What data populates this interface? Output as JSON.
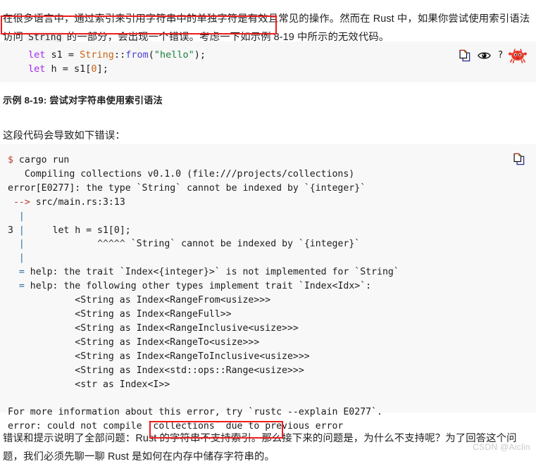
{
  "document": {
    "intro_paragraph": {
      "segment_1": "在很多语言中，通过索引来引用字符串中的单独字符是有效且常见的操作。然而在 Rust 中，如果你尝试使用索引语法访问 ",
      "inline_code": "String",
      "segment_2": " 的一部分，会出现一个错误。考虑一下如示例 8-19 中所示的无效代码。"
    },
    "caption": "示例 8-19: 尝试对字符串使用索引语法",
    "mid_line": "这段代码会导致如下错误：",
    "outro_paragraph": {
      "segment_1": "错误和提示说明了全部问题：",
      "highlighted": "Rust 的字符串不支持索引。",
      "segment_2": "那么接下来的问题是，为什么不支持呢？为了回答这个问题，我们必须先聊一聊 Rust 是如何在内存中储存字符串的。"
    },
    "watermark": "CSDN @Aiclin"
  },
  "code_block": {
    "language": "rust",
    "line_1": {
      "kw_let": "let",
      "var": " s1 = ",
      "type": "String",
      "sep": "::",
      "fn": "from",
      "open": "(",
      "string": "\"hello\"",
      "close": ");"
    },
    "line_2": {
      "kw_let": "let",
      "mid": " h = s1[",
      "num": "0",
      "end": "];"
    },
    "tools": {
      "copy_label": "copy-to-clipboard",
      "eye_label": "show-hidden-lines",
      "question_label": "?",
      "ferris_label": "ferris-not-compile"
    }
  },
  "terminal_block": {
    "lines": [
      "$ cargo run",
      "   Compiling collections v0.1.0 (file:///projects/collections)",
      "error[E0277]: the type `String` cannot be indexed by `{integer}`",
      " --> src/main.rs:3:13",
      "  |",
      "3 |     let h = s1[0];",
      "  |             ^^^^^ `String` cannot be indexed by `{integer}`",
      "  |",
      "  = help: the trait `Index<{integer}>` is not implemented for `String`",
      "  = help: the following other types implement trait `Index<Idx>`:",
      "            <String as Index<RangeFrom<usize>>>",
      "            <String as Index<RangeFull>>",
      "            <String as Index<RangeInclusive<usize>>>",
      "            <String as Index<RangeTo<usize>>>",
      "            <String as Index<RangeToInclusive<usize>>>",
      "            <String as Index<std::ops::Range<usize>>>",
      "            <str as Index<I>>",
      "",
      "For more information about this error, try `rustc --explain E0277`.",
      "error: could not compile `collections` due to previous error"
    ],
    "copy_label": "copy-to-clipboard"
  },
  "colors": {
    "annotation_red": "#ee1c1c",
    "code_bg": "#f6f7f6",
    "terminal_bg": "#f7f8f7",
    "keyword": "#a626f7",
    "type": "#cc6316",
    "function": "#4b3fd6",
    "string": "#19803a",
    "prompt": "#c0392b",
    "pipe": "#2f6f9f"
  }
}
